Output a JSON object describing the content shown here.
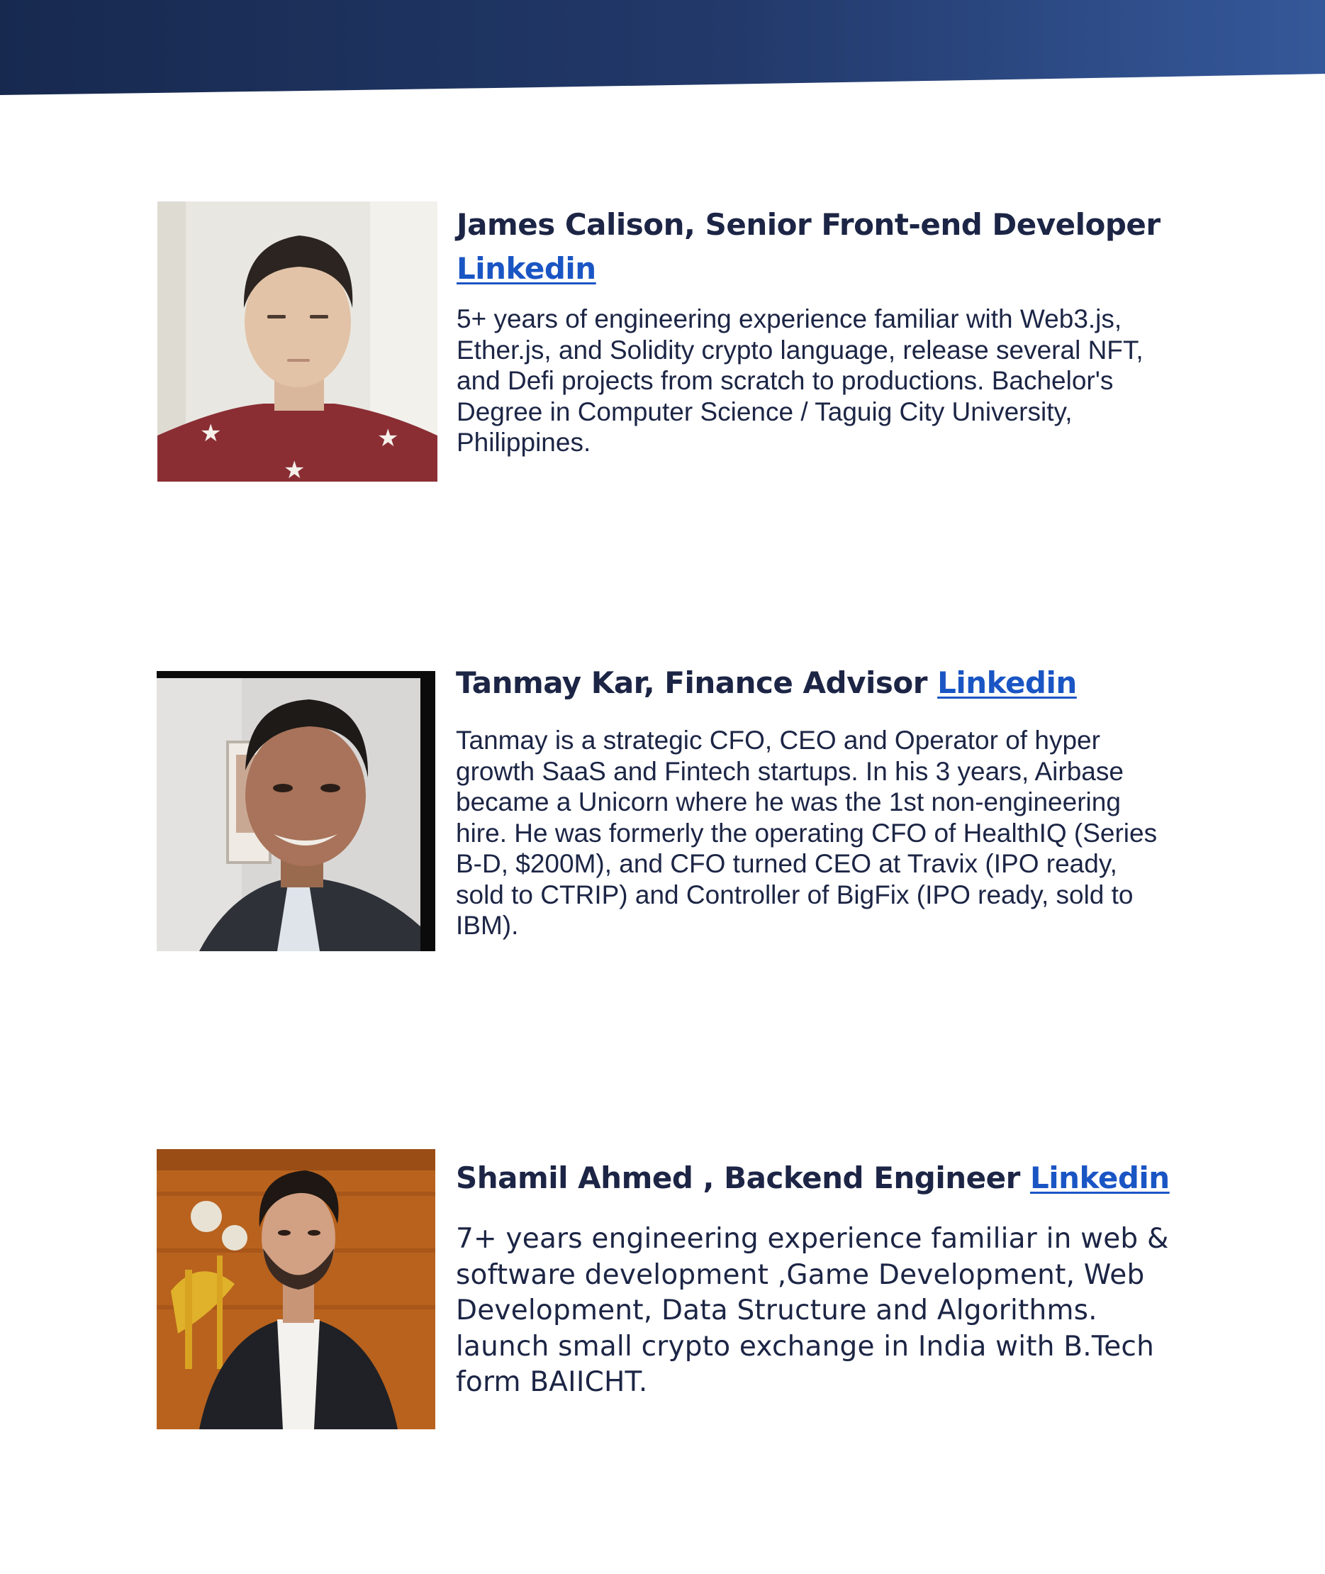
{
  "header": {
    "gradient_start": "#1a2c57",
    "gradient_end": "#3a5d9c"
  },
  "profiles": [
    {
      "name_title": "James Calison, Senior Front-end Developer",
      "link_label": "Linkedin",
      "bio": "5+ years of engineering experience familiar with Web3.js, Ether.js, and Solidity crypto language, release several NFT, and Defi projects from scratch to productions. Bachelor's Degree in Computer Science / Taguig City University, Philippines."
    },
    {
      "name_title": "Tanmay Kar, Finance Advisor",
      "link_label": "Linkedin",
      "bio": "Tanmay is a strategic CFO, CEO and Operator of hyper growth SaaS and Fintech startups. In his 3 years, Airbase became a Unicorn where he was the 1st non-engineering hire. He was formerly the operating CFO of HealthIQ (Series B-D, $200M), and CFO turned CEO at Travix (IPO ready, sold to CTRIP) and Controller of BigFix (IPO ready, sold to IBM)."
    },
    {
      "name_title": "Shamil Ahmed , Backend Engineer",
      "link_label": "Linkedin",
      "bio": "7+ years engineering experience familiar in web & software development ,Game Development, Web Development, Data Structure and Algorithms. launch small crypto exchange in India with B.Tech form BAIICHT."
    }
  ],
  "colors": {
    "text": "#1c2545",
    "link": "#1a55c4"
  }
}
